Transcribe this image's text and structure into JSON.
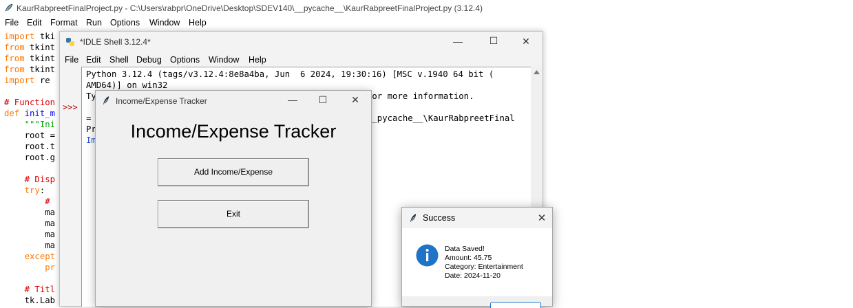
{
  "editor": {
    "title": "KaurRabpreetFinalProject.py - C:\\Users\\rabpr\\OneDrive\\Desktop\\SDEV140\\__pycache__\\KaurRabpreetFinalProject.py (3.12.4)",
    "menu": [
      "File",
      "Edit",
      "Format",
      "Run",
      "Options",
      "Window",
      "Help"
    ],
    "code": [
      {
        "parts": [
          {
            "t": "import",
            "c": "kw"
          },
          {
            "t": " tki",
            "c": "bl"
          }
        ]
      },
      {
        "parts": [
          {
            "t": "from",
            "c": "kw"
          },
          {
            "t": " tkint",
            "c": "bl"
          }
        ]
      },
      {
        "parts": [
          {
            "t": "from",
            "c": "kw"
          },
          {
            "t": " tkint",
            "c": "bl"
          }
        ]
      },
      {
        "parts": [
          {
            "t": "from",
            "c": "kw"
          },
          {
            "t": " tkint",
            "c": "bl"
          }
        ]
      },
      {
        "parts": [
          {
            "t": "import",
            "c": "kw"
          },
          {
            "t": " re",
            "c": "bl"
          }
        ]
      },
      {
        "parts": []
      },
      {
        "parts": [
          {
            "t": "# Function",
            "c": "cm"
          }
        ]
      },
      {
        "parts": [
          {
            "t": "def",
            "c": "kw"
          },
          {
            "t": " ",
            "c": "bl"
          },
          {
            "t": "init_m",
            "c": "df"
          }
        ]
      },
      {
        "parts": [
          {
            "t": "    ",
            "c": "bl"
          },
          {
            "t": "\"\"\"Ini",
            "c": "st"
          }
        ]
      },
      {
        "parts": [
          {
            "t": "    root =",
            "c": "bl"
          }
        ]
      },
      {
        "parts": [
          {
            "t": "    root.t",
            "c": "bl"
          }
        ]
      },
      {
        "parts": [
          {
            "t": "    root.g",
            "c": "bl"
          }
        ]
      },
      {
        "parts": []
      },
      {
        "parts": [
          {
            "t": "    ",
            "c": "bl"
          },
          {
            "t": "# Disp",
            "c": "cm"
          }
        ]
      },
      {
        "parts": [
          {
            "t": "    ",
            "c": "bl"
          },
          {
            "t": "try",
            "c": "kw"
          },
          {
            "t": ":",
            "c": "bl"
          }
        ]
      },
      {
        "parts": [
          {
            "t": "        ",
            "c": "bl"
          },
          {
            "t": "#",
            "c": "cm"
          }
        ]
      },
      {
        "parts": [
          {
            "t": "        ma",
            "c": "bl"
          }
        ]
      },
      {
        "parts": [
          {
            "t": "        ma",
            "c": "bl"
          }
        ]
      },
      {
        "parts": [
          {
            "t": "        ma",
            "c": "bl"
          }
        ]
      },
      {
        "parts": [
          {
            "t": "        ma",
            "c": "bl"
          }
        ]
      },
      {
        "parts": [
          {
            "t": "    ",
            "c": "bl"
          },
          {
            "t": "except",
            "c": "kw"
          }
        ]
      },
      {
        "parts": [
          {
            "t": "        ",
            "c": "bl"
          },
          {
            "t": "pr",
            "c": "kw"
          }
        ]
      },
      {
        "parts": []
      },
      {
        "parts": [
          {
            "t": "    ",
            "c": "bl"
          },
          {
            "t": "# Titl",
            "c": "cm"
          }
        ]
      },
      {
        "parts": [
          {
            "t": "    tk.Lab",
            "c": "bl"
          }
        ]
      }
    ]
  },
  "shell": {
    "title": "*IDLE Shell 3.12.4*",
    "menu": [
      "File",
      "Edit",
      "Shell",
      "Debug",
      "Options",
      "Window",
      "Help"
    ],
    "prompt": ">>>",
    "lines": [
      "Python 3.12.4 (tags/v3.12.4:8e8a4ba, Jun  6 2024, 19:30:16) [MSC v.1940 64 bit (",
      "AMD64)] on win32",
      "Ty",
      "",
      "=",
      "Pr",
      "Im"
    ],
    "line3_tail": "for more information.",
    "line5_tail": "__pycache__\\KaurRabpreetFinal"
  },
  "tracker": {
    "title": "Income/Expense Tracker",
    "heading": "Income/Expense Tracker",
    "add_button": "Add Income/Expense",
    "exit_button": "Exit"
  },
  "success": {
    "title": "Success",
    "lines": [
      "Data Saved!",
      "Amount: 45.75",
      "Category: Entertainment",
      "Date: 2024-11-20"
    ]
  },
  "controls": {
    "minimize": "—",
    "maximize": "☐",
    "close": "✕"
  }
}
